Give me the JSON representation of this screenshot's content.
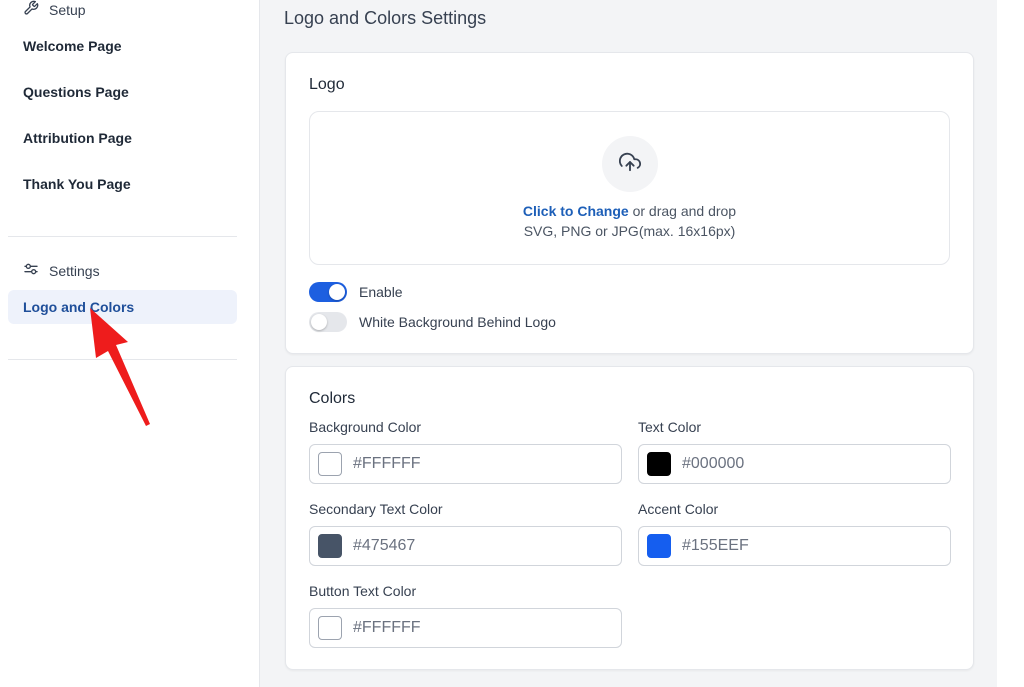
{
  "sidebar": {
    "setup_label": "Setup",
    "items": [
      "Welcome Page",
      "Questions Page",
      "Attribution Page",
      "Thank You Page"
    ],
    "settings_label": "Settings",
    "active_item": "Logo and Colors"
  },
  "page": {
    "title": "Logo and Colors Settings"
  },
  "logo_card": {
    "title": "Logo",
    "upload": {
      "link_text": "Click to Change",
      "rest_text": " or drag and drop",
      "hint": "SVG, PNG or JPG(max. 16x16px)"
    },
    "toggles": [
      {
        "label": "Enable",
        "on": true
      },
      {
        "label": "White Background Behind Logo",
        "on": false
      }
    ]
  },
  "colors_card": {
    "title": "Colors",
    "fields": [
      {
        "label": "Background Color",
        "value": "#FFFFFF",
        "swatch": "#FFFFFF"
      },
      {
        "label": "Text Color",
        "value": "#000000",
        "swatch": "#000000"
      },
      {
        "label": "Secondary Text Color",
        "value": "#475467",
        "swatch": "#475467"
      },
      {
        "label": "Accent Color",
        "value": "#155EEF",
        "swatch": "#155EEF"
      },
      {
        "label": "Button Text Color",
        "value": "#FFFFFF",
        "swatch": "#FFFFFF"
      }
    ]
  },
  "colors": {
    "accent": "#1d5fe0",
    "link": "#1d5fb8",
    "annotation_arrow": "#ee1c1c"
  },
  "icons": {
    "setup": "wrench-icon",
    "settings": "sliders-icon",
    "upload": "cloud-upload-icon"
  }
}
